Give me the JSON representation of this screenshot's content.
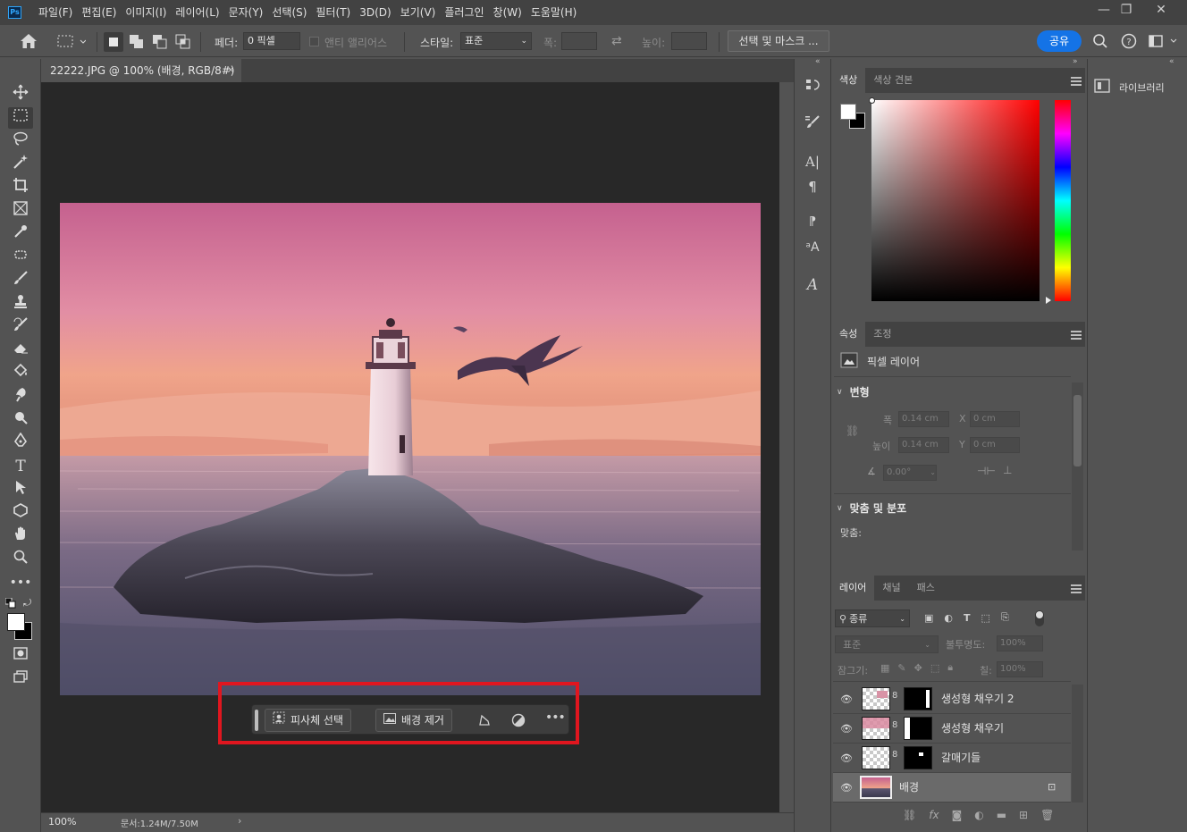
{
  "menu": {
    "logo": "Ps",
    "items": [
      "파일(F)",
      "편집(E)",
      "이미지(I)",
      "레이어(L)",
      "문자(Y)",
      "선택(S)",
      "필터(T)",
      "3D(D)",
      "보기(V)",
      "플러그인",
      "창(W)",
      "도움말(H)"
    ]
  },
  "options": {
    "feather_label": "페더:",
    "feather_value": "0 픽셀",
    "antialias_label": "앤티 앨리어스",
    "style_label": "스타일:",
    "style_value": "표준",
    "width_label": "폭:",
    "height_label": "높이:",
    "select_mask_label": "선택 및 마스크 ...",
    "share_label": "공유"
  },
  "document": {
    "tab_title": "22222.JPG @ 100% (배경, RGB/8#) *",
    "zoom": "100%",
    "doc_size": "문서:1.24M/7.50M"
  },
  "context_bar": {
    "select_subject": "피사체 선택",
    "remove_background": "배경 제거"
  },
  "color_panel": {
    "tabs": [
      "색상",
      "색상 견본"
    ]
  },
  "properties_panel": {
    "tabs": [
      "속성",
      "조정"
    ],
    "layer_type": "픽셀 레이어",
    "transform_title": "변형",
    "w_label": "폭",
    "w_value": "0.14 cm",
    "h_label": "높이",
    "h_value": "0.14 cm",
    "x_label": "X",
    "x_value": "0 cm",
    "y_label": "Y",
    "y_value": "0 cm",
    "angle_value": "0.00°",
    "align_title": "맞춤 및 분포",
    "align_label": "맞춤:"
  },
  "layers_panel": {
    "tabs": [
      "레이어",
      "채널",
      "패스"
    ],
    "filter_kind": "종류",
    "blend_mode": "표준",
    "opacity_label": "불투명도:",
    "opacity_value": "100%",
    "lock_label": "잠그기:",
    "fill_label": "칠:",
    "fill_value": "100%",
    "layers": [
      {
        "name": "생성형 채우기 2"
      },
      {
        "name": "생성형 채우기"
      },
      {
        "name": "갈매기들"
      },
      {
        "name": "배경"
      }
    ]
  },
  "library_panel": {
    "label": "라이브러리"
  },
  "colors": {
    "accent": "#1473e6",
    "highlight_outline": "#e0161f"
  }
}
